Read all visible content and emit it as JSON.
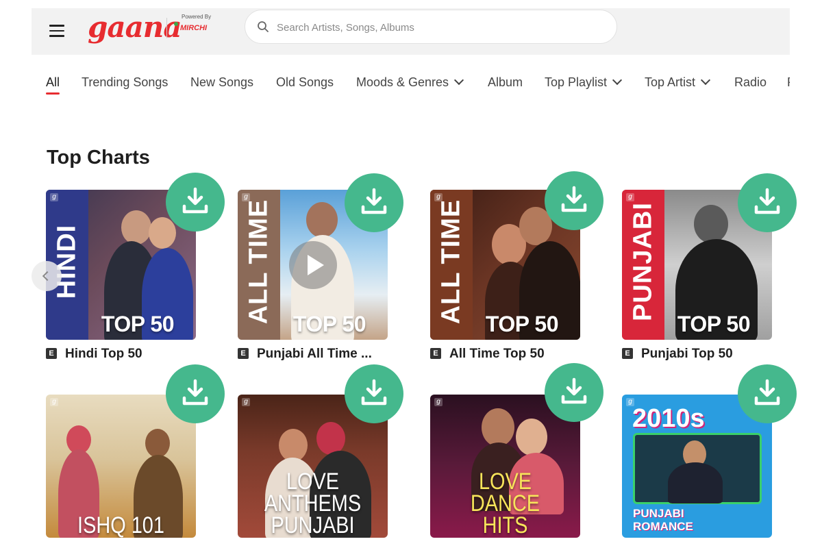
{
  "header": {
    "logo_text": "gaana",
    "powered_by": "Powered By",
    "partner": "MIRCHI",
    "search_placeholder": "Search Artists, Songs, Albums"
  },
  "nav": {
    "items": [
      {
        "label": "All",
        "active": true
      },
      {
        "label": "Trending Songs"
      },
      {
        "label": "New Songs"
      },
      {
        "label": "Old Songs"
      },
      {
        "label": "Moods & Genres",
        "dropdown": true
      },
      {
        "label": "Album"
      },
      {
        "label": "Top Playlist",
        "dropdown": true
      },
      {
        "label": "Top Artist",
        "dropdown": true
      },
      {
        "label": "Radio"
      },
      {
        "label": "P"
      }
    ]
  },
  "section": {
    "title": "Top Charts"
  },
  "cards": [
    {
      "name": "Hindi Top 50",
      "explicit_badge": "E",
      "cover_band": "HINDI",
      "cover_label": "TOP 50"
    },
    {
      "name": "Punjabi All Time ...",
      "explicit_badge": "E",
      "cover_band": "ALL TIME",
      "cover_label": "TOP 50"
    },
    {
      "name": "All Time Top 50",
      "explicit_badge": "E",
      "cover_band": "ALL TIME",
      "cover_label": "TOP 50"
    },
    {
      "name": "Punjabi Top 50",
      "explicit_badge": "E",
      "cover_band": "PUNJABI",
      "cover_label": "TOP 50"
    },
    {
      "cover_title": "ISHQ 101"
    },
    {
      "cover_title": "LOVE ANTHEMS PUNJABI"
    },
    {
      "cover_title": "LOVE DANCE HITS"
    },
    {
      "cover_title_top": "2010s",
      "cover_title": "PUNJABI ROMANCE"
    }
  ],
  "colors": {
    "brand_red": "#e72c30",
    "download_green": "#45b88d",
    "header_bg": "#f2f2f2"
  },
  "icons": [
    "menu-icon",
    "search-icon",
    "download-icon",
    "play-icon",
    "chevron-down-icon",
    "chevron-left-icon"
  ]
}
